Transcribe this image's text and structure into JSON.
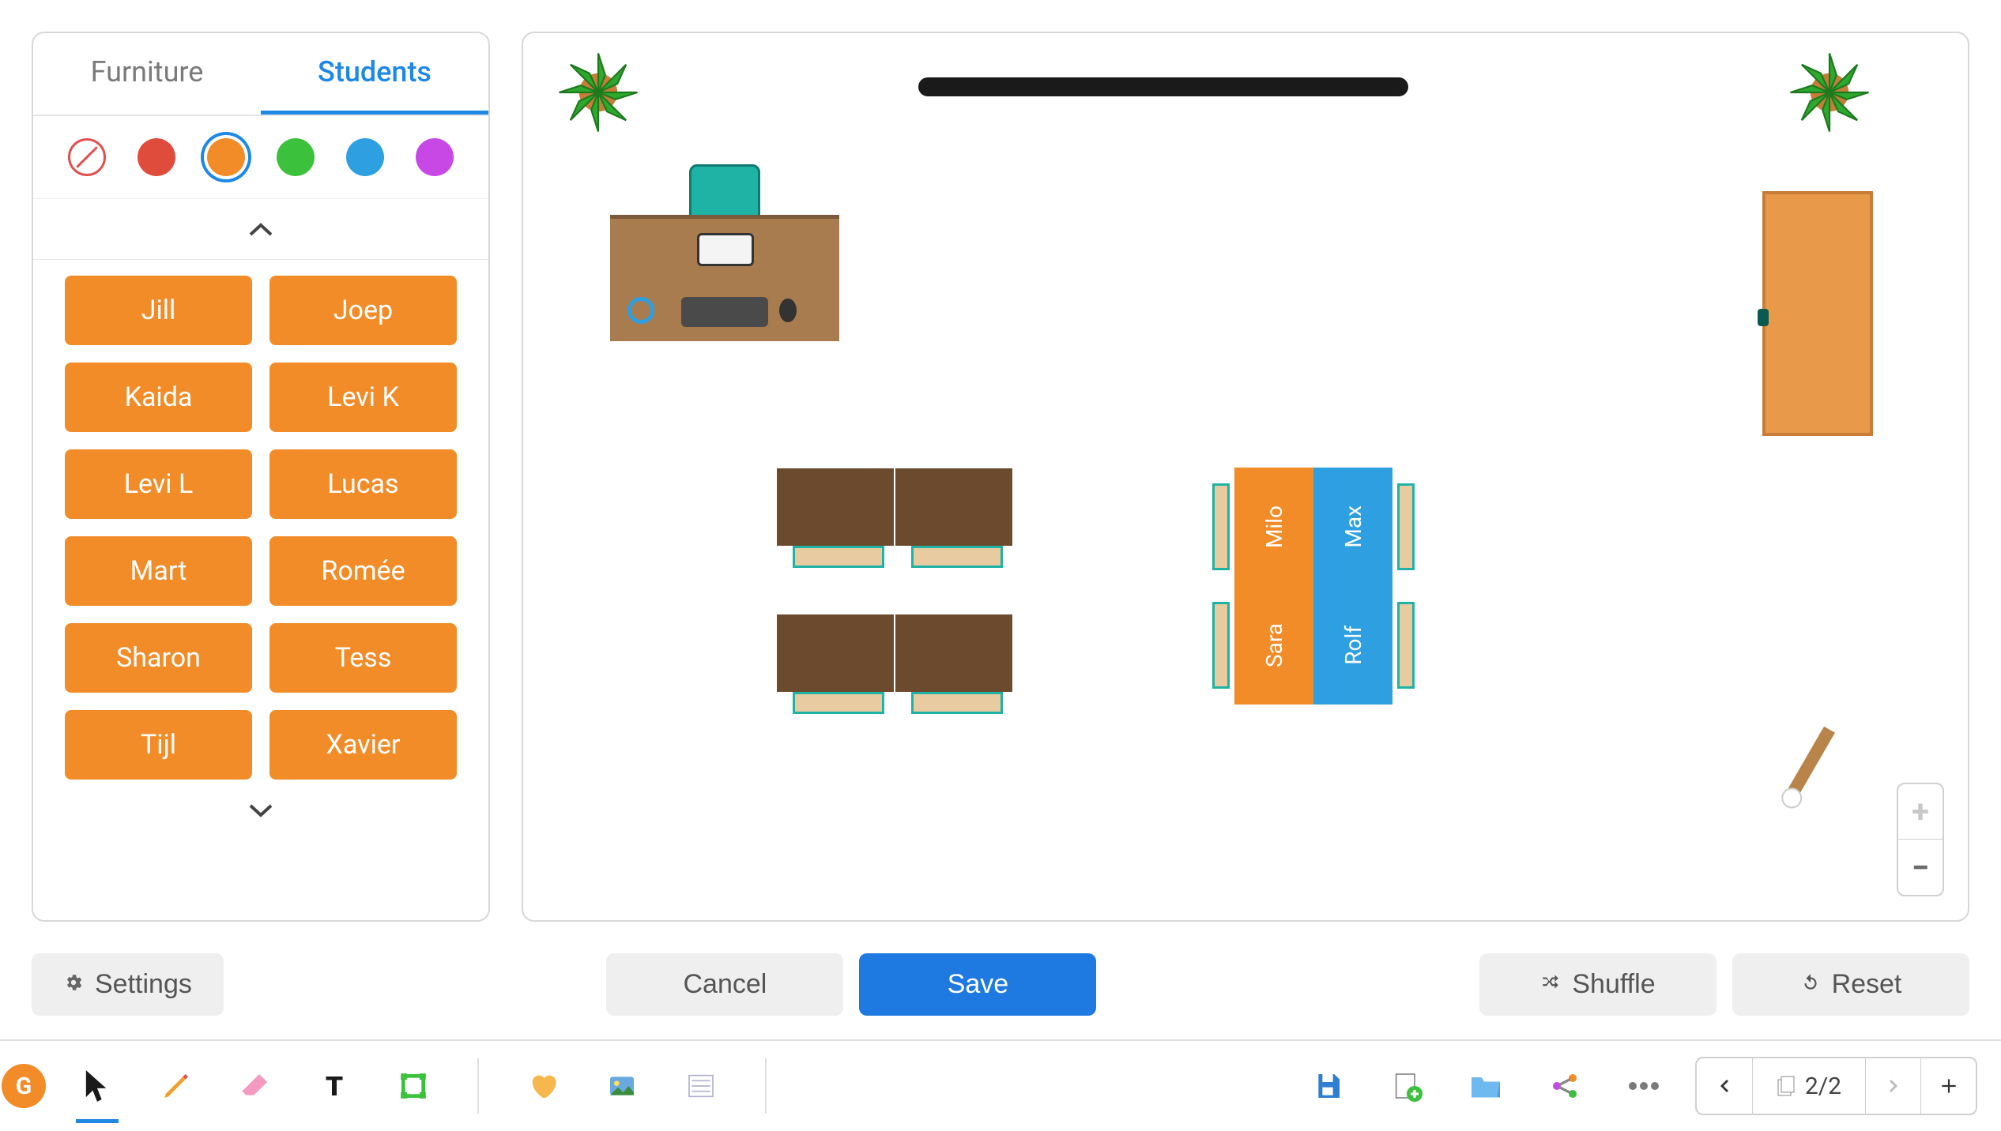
{
  "tabs": {
    "furniture": "Furniture",
    "students": "Students"
  },
  "colors": {
    "none": "#ffffff",
    "red": "#e04c3c",
    "orange": "#f28c28",
    "green": "#3cc13c",
    "blue": "#2e9fe0",
    "purple": "#c848e6",
    "selected": "orange"
  },
  "students": [
    "Jill",
    "Joep",
    "Kaida",
    "Levi K",
    "Levi L",
    "Lucas",
    "Mart",
    "Romée",
    "Sharon",
    "Tess",
    "Tijl",
    "Xavier"
  ],
  "seating": {
    "group": [
      {
        "name": "Milo",
        "color": "orange"
      },
      {
        "name": "Max",
        "color": "blue"
      },
      {
        "name": "Sara",
        "color": "orange"
      },
      {
        "name": "Rolf",
        "color": "blue"
      }
    ]
  },
  "actions": {
    "settings": "Settings",
    "cancel": "Cancel",
    "save": "Save",
    "shuffle": "Shuffle",
    "reset": "Reset"
  },
  "pagination": {
    "current": 2,
    "total": 2,
    "display": "2/2"
  },
  "toolbar": {
    "badge": "G"
  }
}
